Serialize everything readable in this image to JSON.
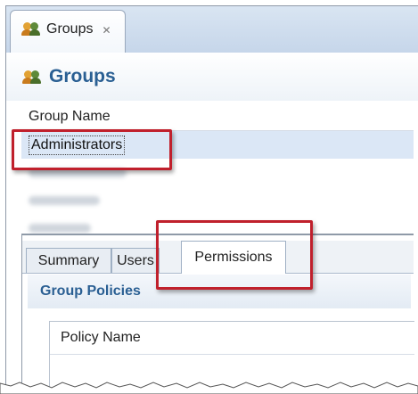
{
  "editor_tab": {
    "title": "Groups",
    "close_glyph": "✕",
    "icon": "groups-icon"
  },
  "header": {
    "title": "Groups",
    "icon": "groups-icon"
  },
  "groups_table": {
    "column_header": "Group Name",
    "rows": [
      {
        "name": "Administrators",
        "selected": true
      },
      {
        "name": "",
        "obscured": true
      },
      {
        "name": "",
        "obscured": true
      },
      {
        "name": "",
        "obscured": true
      }
    ]
  },
  "detail_tabs": [
    "Summary",
    "Users",
    "Permissions"
  ],
  "active_detail_tab": "Permissions",
  "group_policies": {
    "title": "Group Policies",
    "column_header": "Policy Name"
  },
  "colors": {
    "callout": "#c0202c",
    "heading": "#2a5f93",
    "selection": "#dbe7f6"
  }
}
